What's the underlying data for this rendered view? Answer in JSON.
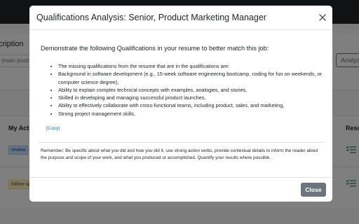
{
  "background": {
    "description_label": "cription",
    "description_placeholder": "(main posit",
    "analyze_button": "Analyz",
    "actions_header": "My Actio",
    "results_header": "Resu",
    "badges": [
      "review",
      "follow-up"
    ]
  },
  "modal": {
    "title": "Qualifications Analysis: Senior, Product Marketing Manager",
    "intro": "Demonstrate the following Qualifications in your resume to better match this job:",
    "items": [
      "The missing qualifications from the resume that are in the qualifications are:",
      "Background in software development (e.g., 15-week software engineering bootcamp, coding for fun on weekends, or computer science degree),",
      "Ability to explain complex technical concepts with examples, analogies, and stories,",
      "Skilled in developing and managing successful product launches,",
      "Ability to effectively collaborate with cross-functional teams, including product, sales, and marketing,",
      "Strong project management skills,"
    ],
    "copy_link": "[Copy]",
    "reminder": "Remember: Be specific about what you did and how you did it, use strong action verbs, provide contextual details to inform the reader about the purpose and scope of your work, and what you produced or accomplished. Quantify your results where possible.",
    "close_button": "Close"
  },
  "icons": {
    "close": "close-icon",
    "list": "list-check-icon"
  },
  "colors": {
    "link": "#0d6efd",
    "secondary_button": "#6c757d",
    "results_icon": "#198754"
  }
}
